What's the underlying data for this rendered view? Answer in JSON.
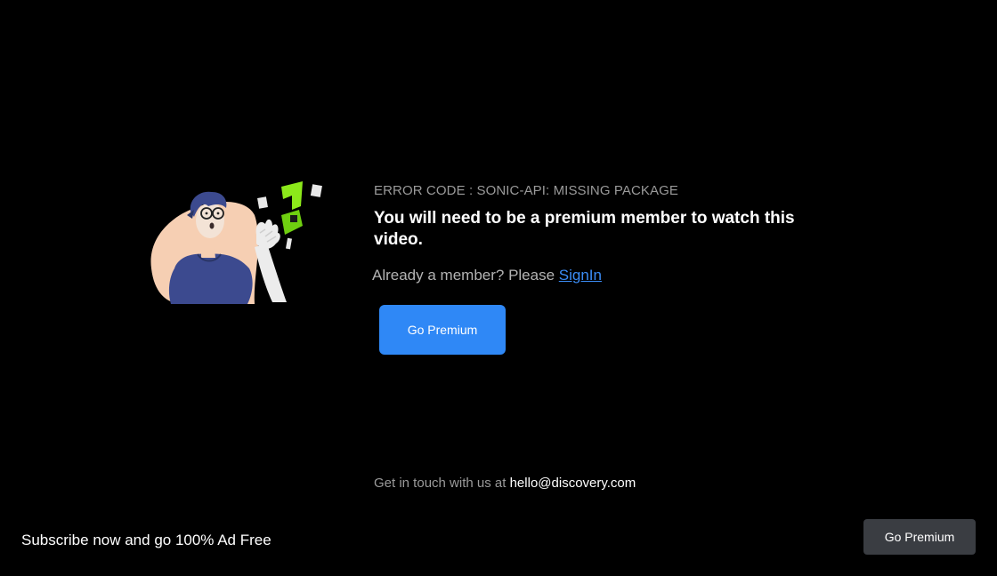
{
  "error": {
    "code": "ERROR CODE : SONIC-API: MISSING PACKAGE",
    "message": "You will need to be a premium member to watch this video."
  },
  "signin": {
    "prompt": "Already a member? Please",
    "link_label": "SignIn"
  },
  "primary_button": {
    "label": "Go Premium"
  },
  "contact": {
    "prompt": "Get in touch with us at",
    "email": "hello@discovery.com"
  },
  "footer": {
    "banner_text": "Subscribe now and go 100% Ad Free",
    "button_label": "Go Premium"
  },
  "illustration": {
    "icon": "surprised-person-illustration"
  },
  "colors": {
    "background": "#000000",
    "accent_blue": "#2f88f6",
    "link_blue": "#3b8cf5",
    "footer_button": "#3a3d42",
    "brand_green": "#8ce81a"
  }
}
